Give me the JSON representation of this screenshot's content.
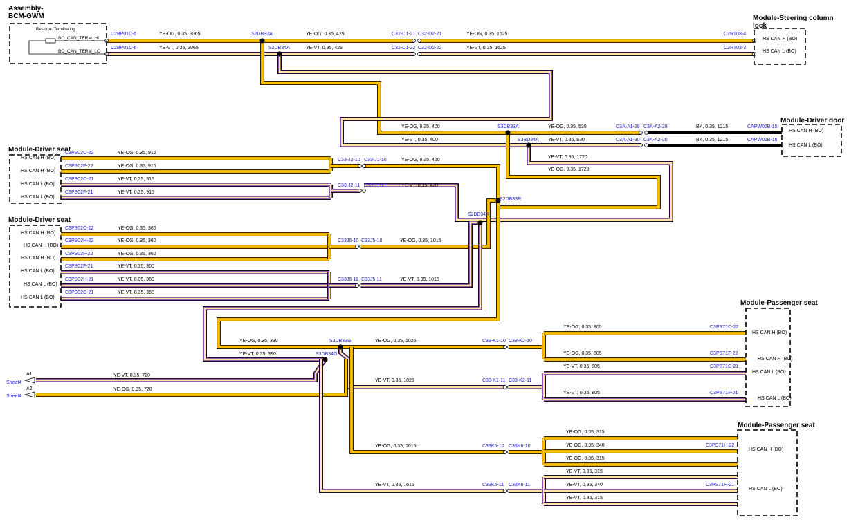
{
  "modules": {
    "bcm": {
      "title_line1": "Assembly-",
      "title_line2": "BCM-GWM",
      "resistor": "Resistor-\nTerminating",
      "pin_hi": "BO_CAN_TERM_HI",
      "pin_lo": "BO_CAN_TERM_LO"
    },
    "steering": {
      "title_line1": "Module-Steering column",
      "title_line2": "lock",
      "pin1": "HS CAN H (BO)",
      "pin2": "HS CAN L (BO)"
    },
    "driver_door": {
      "title": "Module-Driver door",
      "pin1": "HS CAN H (BO)",
      "pin2": "HS CAN L (BO)"
    },
    "driver_seat_1": {
      "title": "Module-Driver seat",
      "pins": [
        "HS CAN H (BO)",
        "HS CAN H (BO)",
        "HS CAN L (BO)",
        "HS CAN L (BO)"
      ]
    },
    "driver_seat_2": {
      "title": "Module-Driver seat",
      "pins": [
        "HS CAN H (BO)",
        "HS CAN H (BO)",
        "HS CAN H (BO)",
        "HS CAN L (BO)",
        "HS CAN L (BO)",
        "HS CAN L (BO)"
      ]
    },
    "passenger_seat_1": {
      "title": "Module-Passenger seat",
      "pins": [
        "HS CAN H (BO)",
        "HS CAN H (BO)",
        "HS CAN L (BO)",
        "HS CAN L (BO)"
      ]
    },
    "passenger_seat_2": {
      "title": "Module-Passenger seat",
      "pins": [
        "HS CAN H (BO)",
        "HS CAN L (BO)"
      ]
    }
  },
  "connectors": {
    "c2bp01c5": "C2BP01C-5",
    "c2bp01c6": "C2BP01C-6",
    "c32d121": "C32-D1-21",
    "c32d221": "C32-D2-21",
    "c32d122": "C32-D1-22",
    "c32d222": "C32-D2-22",
    "c2rt034": "C2RT03-4",
    "c2rt033": "C2RT03-3",
    "c3aa129": "C3A-A1-29",
    "c3aa229": "C3A-A2-29",
    "c3aa130": "C3A-A1-30",
    "c3aa230": "C3A-A2-30",
    "capw02b15": "CAPW02B-15",
    "capw02b16": "CAPW02B-16",
    "c33j210": "C33-J2-10",
    "c33j110": "C33-J1-10",
    "c33j211": "C33-J2-11",
    "c33j111": "C33-J1-11",
    "c33j610": "C33J6-10",
    "c33j510": "C33J5-10",
    "c33j611": "C33J6-11",
    "c33j511": "C33J5-11",
    "c33k110": "C33-K1-10",
    "c33k210": "C33-K2-10",
    "c33k111": "C33-K1-11",
    "c33k211": "C33-K2-11",
    "c33k510": "C33K5-10",
    "c33k610": "C33K6-10",
    "c33k511": "C33K5-11",
    "c33k611": "C33K6-11",
    "ds1": [
      "C3PS02C-22",
      "C3PS02F-22",
      "C3PS02C-21",
      "C3PS02F-21"
    ],
    "ds2": [
      "C3PS02C-22",
      "C3PS02H-22",
      "C3PS02F-22",
      "C3PS02F-21",
      "C3PS02H-21",
      "C3PS02C-21"
    ],
    "ps1": [
      "C3PS71C-22",
      "C3PS71F-22",
      "C3PS71C-21",
      "C3PS71F-21"
    ],
    "ps2": [
      "C3PS71H-22",
      "C3PS71H-21"
    ]
  },
  "splices": {
    "s2db33a": "S2DB33A",
    "s2db34a": "S2DB34A",
    "s3db33a": "S3DB33A",
    "s3bd34a": "S3BD34A",
    "s2db33r": "S2DB33R",
    "s2db34r": "S2DB34R",
    "s3db33g": "S3DB33G",
    "s3db34g": "S3DB34G"
  },
  "wires": {
    "bcm_hi": "YE-OG, 0.35, 3065",
    "bcm_lo": "YE-VT, 0.35, 3065",
    "top_hi": "YE-OG, 0.35, 425",
    "top_lo": "YE-VT, 0.35, 425",
    "steer_hi": "YE-OG, 0.35, 1625",
    "steer_lo": "YE-VT, 0.35, 1625",
    "door_in_hi": "YE-OG, 0.35, 400",
    "door_in_lo": "YE-VT, 0.35, 400",
    "door_hi": "YE-OG, 0.35, 530",
    "door_lo": "YE-VT, 0.35, 530",
    "door_bk1": "BK, 0.35, 1215",
    "door_bk2": "BK, 0.35, 1215",
    "drop_lo": "YE-VT, 0.35, 1720",
    "drop_hi": "YE-OG, 0.35, 1720",
    "ds1_wires": [
      "YE-OG, 0.35, 915",
      "YE-OG, 0.35, 915",
      "YE-VT, 0.35, 915",
      "YE-VT, 0.35, 915"
    ],
    "ds1_hi": "YE-OG, 0.35, 420",
    "ds1_lo": "YE-VT, 0.35, 420",
    "ds2_wires": [
      "YE-OG, 0.35, 360",
      "YE-OG, 0.35, 360",
      "YE-OG, 0.35, 360",
      "YE-VT, 0.35, 360",
      "YE-VT, 0.35, 360",
      "YE-VT, 0.35, 360"
    ],
    "ds2_hi": "YE-OG, 0.35, 1015",
    "ds2_lo": "YE-VT, 0.35, 1015",
    "g_in_hi": "YE-OG, 0.35, 390",
    "g_in_lo": "YE-VT, 0.35, 390",
    "g_hi": "YE-OG, 0.35, 1025",
    "g_lo": "YE-VT, 0.35, 1025",
    "sheet_a1": "YE-VT, 0.35, 720",
    "sheet_a2": "YE-OG, 0.35, 720",
    "ps1_wires": [
      "YE-OG, 0.35, 805",
      "YE-OG, 0.35, 805",
      "YE-VT, 0.35, 805",
      "YE-VT, 0.35, 805"
    ],
    "ps2_hi": "YE-OG, 0.35, 1615",
    "ps2_lo": "YE-VT, 0.35, 1615",
    "ps2_wires": [
      "YE-OG, 0.35, 315",
      "YE-OG, 0.35, 340",
      "YE-OG, 0.35, 315",
      "YE-VT, 0.35, 315",
      "YE-VT, 0.35, 340",
      "YE-VT, 0.35, 315"
    ]
  },
  "offpage": {
    "a1": "A1",
    "a2": "A2",
    "sheet1": "Sheet4",
    "sheet2": "Sheet4"
  },
  "colors": {
    "og_core": "#f5c400",
    "og_trace": "#e8a200",
    "vt_core": "#f7e9a0",
    "vt_trace": "#7b2fb0",
    "black": "#000000",
    "label_blue": "#1a1acc"
  }
}
